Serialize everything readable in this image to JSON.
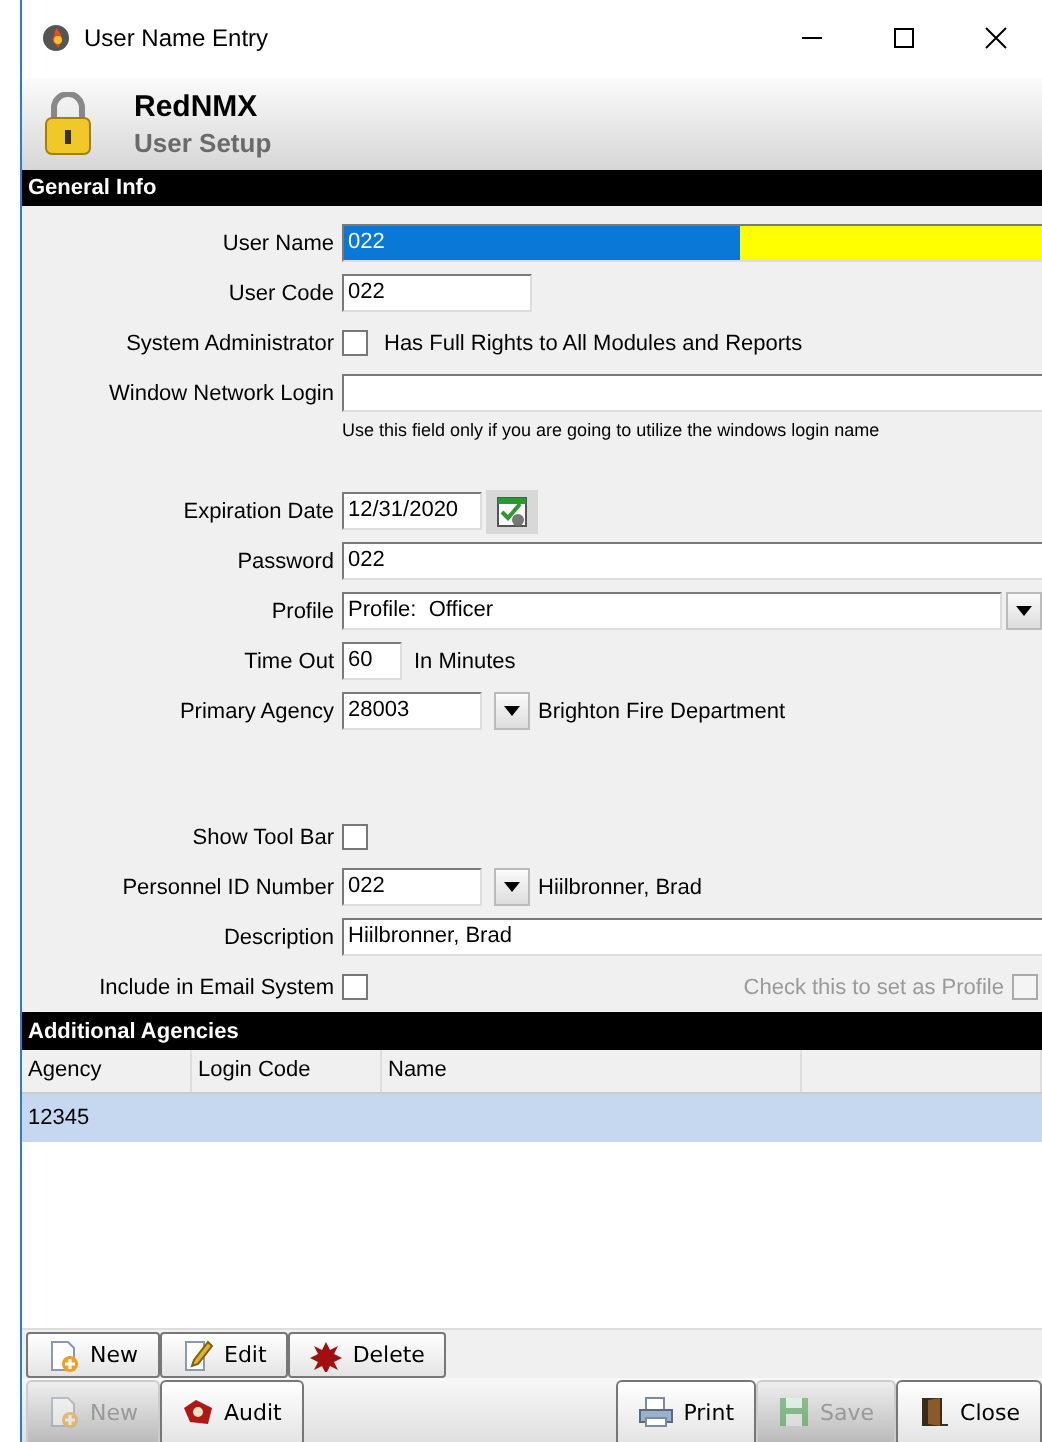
{
  "window": {
    "title": "User Name Entry"
  },
  "header": {
    "app_name": "RedNMX",
    "subtitle": "User Setup"
  },
  "general_info": {
    "title": "General Info",
    "groups": [
      {
        "rows": [
          {
            "kind": "text",
            "label": "User Name",
            "value": "022",
            "focused": true
          },
          {
            "kind": "short",
            "label": "User Code",
            "value": "022"
          },
          {
            "kind": "checkbox",
            "label": "System Administrator",
            "checked": false,
            "caption": "Has Full Rights to All Modules and Reports"
          },
          {
            "kind": "text",
            "label": "Window Network Login",
            "hint": "Use this field only if you are going to utilize the windows login name"
          }
        ]
      },
      {
        "rows": [
          {
            "kind": "date",
            "label": "Expiration Date",
            "value": "12/31/2020"
          },
          {
            "kind": "text",
            "label": "Password",
            "value": "022"
          },
          {
            "kind": "dropdown",
            "label": "Profile",
            "value": "Profile:  Officer"
          },
          {
            "kind": "number",
            "label": "Time Out",
            "value": "60",
            "suffix": "In Minutes"
          },
          {
            "kind": "lookup",
            "label": "Primary Agency",
            "value": "28003",
            "name": "Brighton Fire Department"
          }
        ]
      },
      {
        "rows": [
          {
            "kind": "checkbox",
            "label": "Show Tool Bar",
            "checked": false
          },
          {
            "kind": "lookup",
            "label": "Personnel ID Number",
            "value": "022",
            "name": "Hiilbronner, Brad"
          },
          {
            "kind": "text",
            "label": "Description",
            "value": "Hiilbronner, Brad"
          },
          {
            "kind": "checkbox",
            "label": "Include in Email System",
            "checked": false,
            "side_option": {
              "label": "Check this to set as Profile",
              "checked": false,
              "disabled": true
            }
          }
        ]
      }
    ]
  },
  "additional_agencies": {
    "title": "Additional Agencies",
    "columns": [
      "Agency",
      "Login Code",
      "Name"
    ],
    "rows": [
      {
        "cells": [
          "12345"
        ],
        "selected": true
      }
    ],
    "buttons": [
      {
        "kind": "new",
        "label": "New"
      },
      {
        "kind": "edit",
        "label": "Edit"
      },
      {
        "kind": "delete",
        "label": "Delete"
      }
    ]
  },
  "footer": {
    "left": [
      {
        "kind": "new",
        "label": "New",
        "disabled": true
      },
      {
        "kind": "audit",
        "label": "Audit",
        "disabled": false
      }
    ],
    "right": [
      {
        "kind": "print",
        "label": "Print",
        "disabled": false
      },
      {
        "kind": "save",
        "label": "Save",
        "disabled": true
      },
      {
        "kind": "close",
        "label": "Close",
        "disabled": false
      }
    ]
  }
}
